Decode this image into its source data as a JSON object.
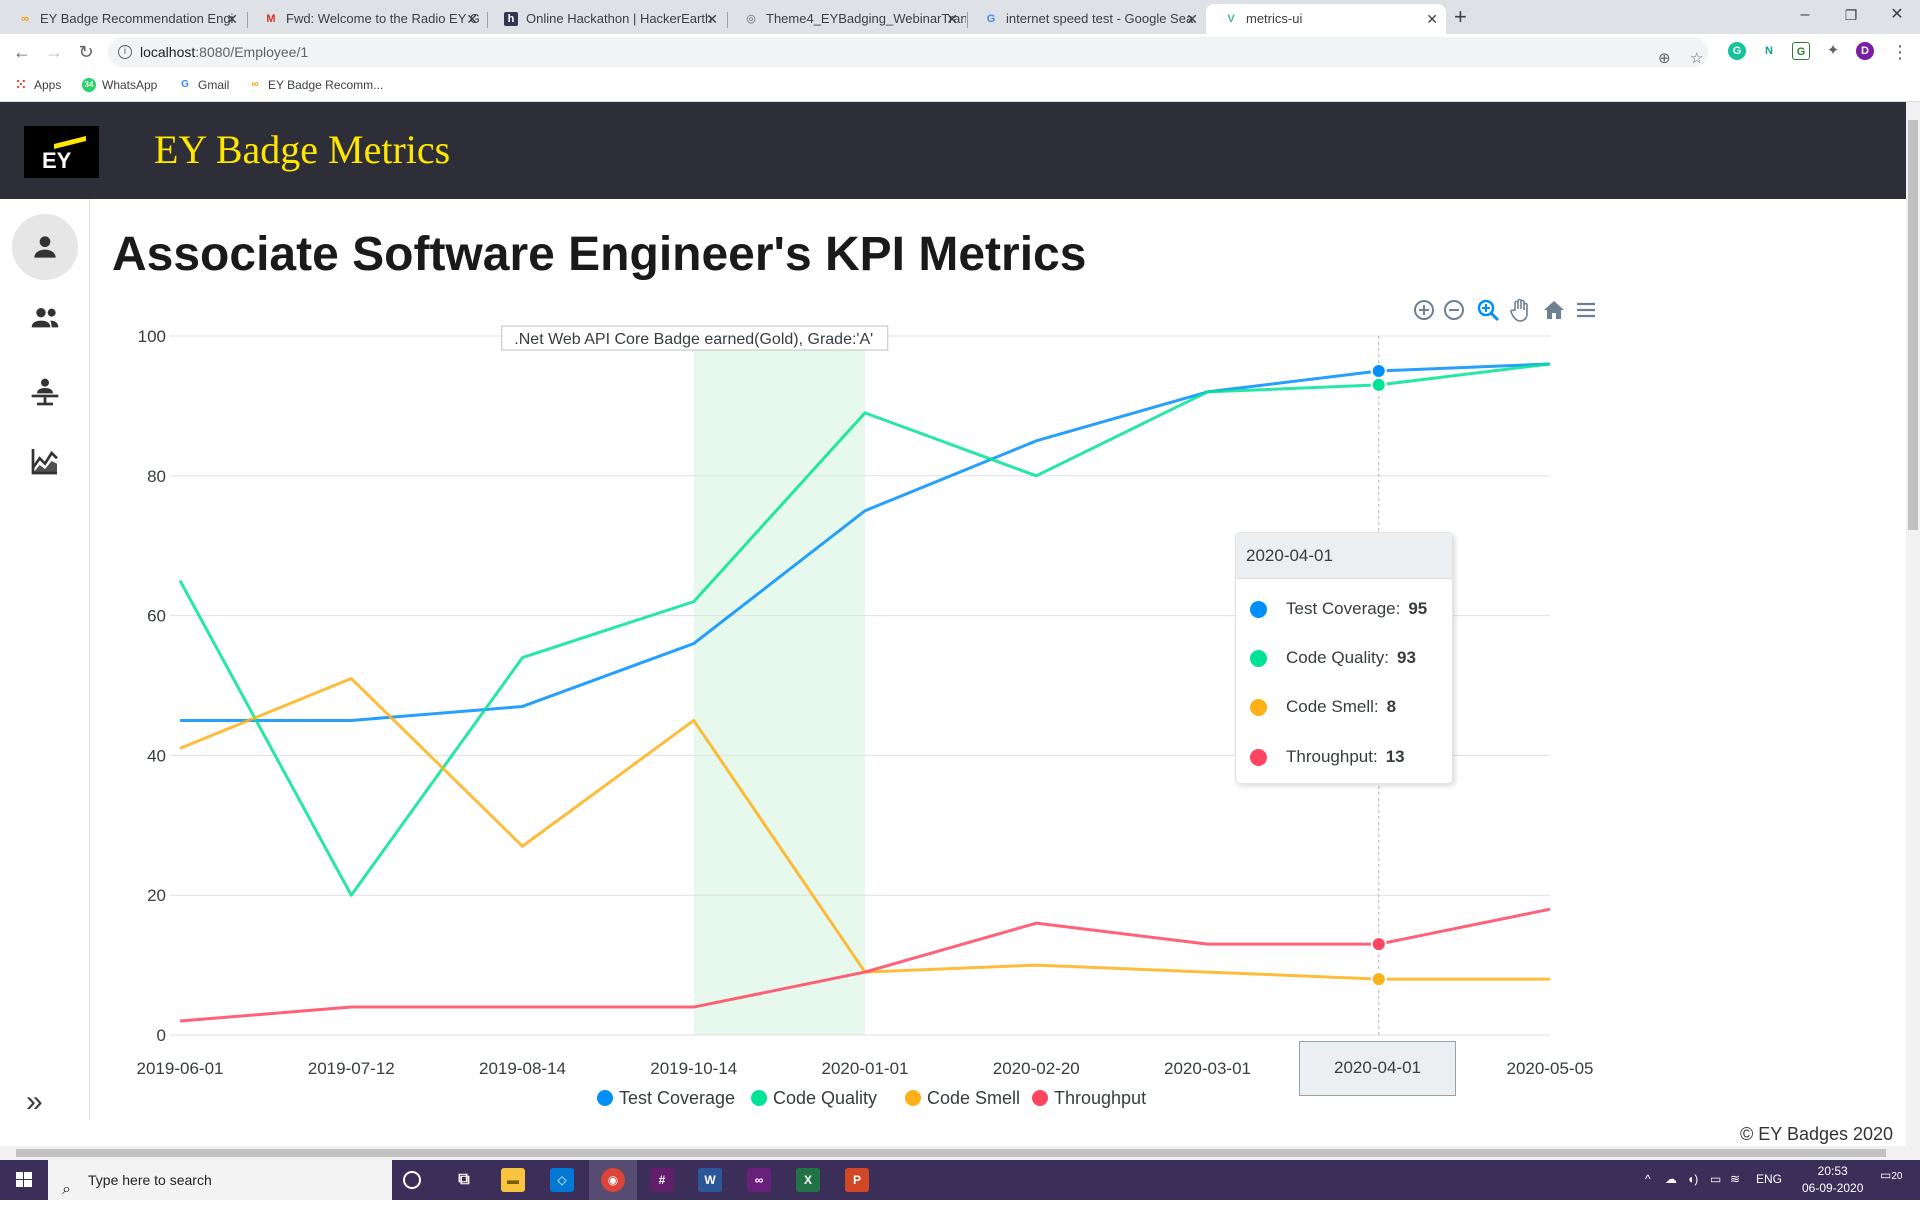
{
  "browser": {
    "tabs": [
      {
        "title": "EY Badge Recommendation Engi",
        "icon": "ey-icon",
        "active": false
      },
      {
        "title": "Fwd: Welcome to the Radio EY G",
        "icon": "gmail-icon",
        "active": false
      },
      {
        "title": "Online Hackathon | HackerEarth",
        "icon": "hackerearth-icon",
        "active": false
      },
      {
        "title": "Theme4_EYBadging_WebinarTran",
        "icon": "globe-icon",
        "active": false
      },
      {
        "title": "internet speed test - Google Sea",
        "icon": "google-icon",
        "active": false
      },
      {
        "title": "metrics-ui",
        "icon": "vue-icon",
        "active": true
      }
    ],
    "url_host": "localhost",
    "url_path": ":8080/Employee/1",
    "bookmarks": [
      {
        "label": "Apps",
        "icon": "apps-grid-icon"
      },
      {
        "label": "WhatsApp",
        "icon": "whatsapp-icon",
        "badge": "34"
      },
      {
        "label": "Gmail",
        "icon": "google-icon"
      },
      {
        "label": "EY Badge Recomm...",
        "icon": "ey-icon"
      }
    ],
    "profile_initial": "D"
  },
  "app": {
    "logo_text": "EY",
    "title": "EY Badge Metrics",
    "sidebar": [
      {
        "name": "person-icon",
        "active": true
      },
      {
        "name": "people-icon",
        "active": false
      },
      {
        "name": "presenter-icon",
        "active": false
      },
      {
        "name": "line-chart-icon",
        "active": false
      }
    ],
    "expand_icon": "double-chevron-right-icon",
    "page_title": "Associate Software Engineer's KPI Metrics",
    "footer": "© EY Badges 2020"
  },
  "toolbar_icons": [
    "zoom-in-icon",
    "zoom-out-icon",
    "selection-zoom-icon",
    "pan-hand-icon",
    "reset-home-icon",
    "menu-icon"
  ],
  "chart_data": {
    "type": "line",
    "categories": [
      "2019-06-01",
      "2019-07-12",
      "2019-08-14",
      "2019-10-14",
      "2020-01-01",
      "2020-02-20",
      "2020-03-01",
      "2020-04-01",
      "2020-05-05"
    ],
    "ylim": [
      0,
      100
    ],
    "yticks": [
      0,
      20,
      40,
      60,
      80,
      100
    ],
    "grid": true,
    "legend_position": "bottom",
    "series": [
      {
        "name": "Test Coverage",
        "color": "#008ffb",
        "values": [
          45,
          45,
          47,
          56,
          75,
          85,
          92,
          95,
          96
        ]
      },
      {
        "name": "Code Quality",
        "color": "#00e396",
        "values": [
          65,
          20,
          54,
          62,
          89,
          80,
          92,
          93,
          96
        ]
      },
      {
        "name": "Code Smell",
        "color": "#feb019",
        "values": [
          41,
          51,
          27,
          45,
          9,
          10,
          9,
          8,
          8
        ]
      },
      {
        "name": "Throughput",
        "color": "#ff4560",
        "values": [
          2,
          4,
          4,
          4,
          9,
          16,
          13,
          13,
          18
        ]
      }
    ],
    "annotation": {
      "label": ".Net Web API Core Badge earned(Gold), Grade:'A'",
      "from": "2019-10-14",
      "to": "2020-01-01",
      "color": "#e6f9ec"
    },
    "hover": {
      "x": "2020-04-01",
      "index": 7
    }
  },
  "tooltip": {
    "title": "2020-04-01",
    "rows": [
      {
        "label": "Test Coverage:",
        "value": "95",
        "color": "#008ffb"
      },
      {
        "label": "Code Quality:",
        "value": "93",
        "color": "#00e396"
      },
      {
        "label": "Code Smell:",
        "value": "8",
        "color": "#feb019"
      },
      {
        "label": "Throughput:",
        "value": "13",
        "color": "#ff4560"
      }
    ]
  },
  "taskbar": {
    "search_placeholder": "Type here to search",
    "language": "ENG",
    "time": "20:53",
    "date": "06-09-2020",
    "notifications": "20"
  }
}
